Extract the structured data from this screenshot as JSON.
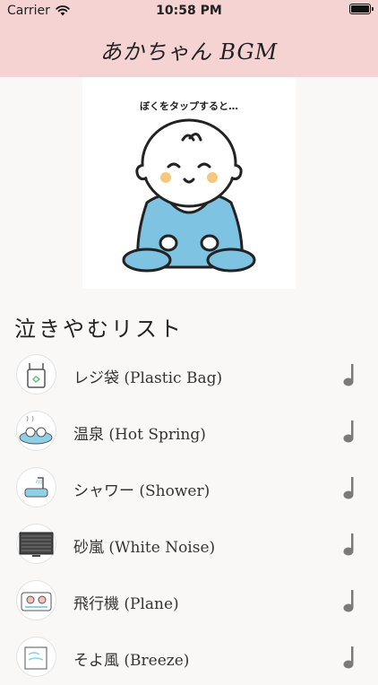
{
  "status_bar": {
    "carrier": "Carrier",
    "time": "10:58 PM"
  },
  "nav": {
    "title": "あかちゃん BGM"
  },
  "hero": {
    "caption": "ぼくをタップすると…"
  },
  "section": {
    "title": "泣きやむリスト"
  },
  "list": [
    {
      "label": "レジ袋 (Plastic Bag)",
      "icon": "plastic-bag-icon"
    },
    {
      "label": "温泉 (Hot Spring)",
      "icon": "hot-spring-icon"
    },
    {
      "label": "シャワー (Shower)",
      "icon": "shower-icon"
    },
    {
      "label": "砂嵐 (White Noise)",
      "icon": "tv-static-icon"
    },
    {
      "label": "飛行機 (Plane)",
      "icon": "plane-icon"
    },
    {
      "label": "そよ風 (Breeze)",
      "icon": "breeze-icon"
    }
  ],
  "colors": {
    "nav_background": "#f5d3d3",
    "baby_suit": "#7ec3e2",
    "cheek": "#f6c87f",
    "note_icon": "#7a7a7a"
  }
}
